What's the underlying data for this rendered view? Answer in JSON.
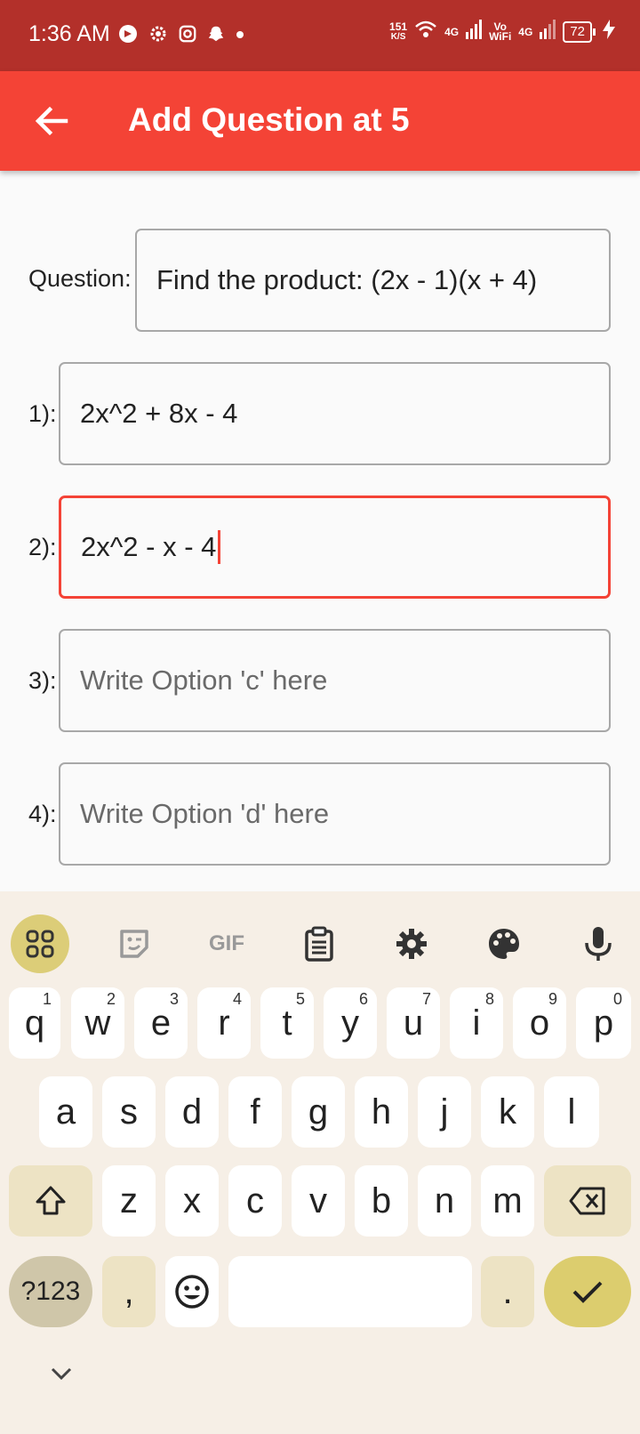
{
  "status_bar": {
    "time": "1:36 AM",
    "net_speed_value": "151",
    "net_speed_unit": "K/S",
    "signal1": "4G",
    "volte": "Vo",
    "wifi_label": "WiFi",
    "signal2": "4G",
    "battery": "72"
  },
  "app_bar": {
    "title": "Add Question at 5"
  },
  "form": {
    "question_label": "Question:",
    "question_value": "Find the product: (2x - 1)(x + 4)",
    "options": [
      {
        "label": "1):",
        "value": "2x^2 + 8x - 4",
        "placeholder": ""
      },
      {
        "label": "2):",
        "value": "2x^2 - x - 4",
        "placeholder": ""
      },
      {
        "label": "3):",
        "value": "",
        "placeholder": "Write Option 'c' here"
      },
      {
        "label": "4):",
        "value": "",
        "placeholder": "Write Option 'd' here"
      }
    ]
  },
  "keyboard": {
    "toolbar": [
      "apps-icon",
      "sticker-icon",
      "gif-icon",
      "clipboard-icon",
      "settings-icon",
      "palette-icon",
      "mic-icon"
    ],
    "gif_label": "GIF",
    "row1": [
      {
        "key": "q",
        "num": "1"
      },
      {
        "key": "w",
        "num": "2"
      },
      {
        "key": "e",
        "num": "3"
      },
      {
        "key": "r",
        "num": "4"
      },
      {
        "key": "t",
        "num": "5"
      },
      {
        "key": "y",
        "num": "6"
      },
      {
        "key": "u",
        "num": "7"
      },
      {
        "key": "i",
        "num": "8"
      },
      {
        "key": "o",
        "num": "9"
      },
      {
        "key": "p",
        "num": "0"
      }
    ],
    "row2": [
      "a",
      "s",
      "d",
      "f",
      "g",
      "h",
      "j",
      "k",
      "l"
    ],
    "row3": [
      "z",
      "x",
      "c",
      "v",
      "b",
      "n",
      "m"
    ],
    "symbols_key": "?123",
    "comma_key": ",",
    "period_key": "."
  },
  "colors": {
    "status_bar": "#b3302a",
    "app_bar": "#f44336",
    "focus": "#f44336"
  }
}
